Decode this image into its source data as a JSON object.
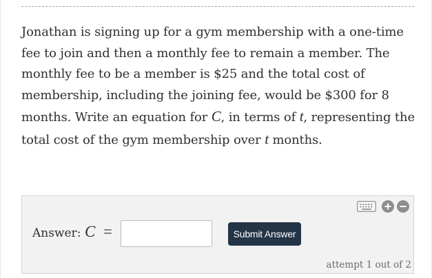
{
  "question": {
    "segments": [
      {
        "type": "text",
        "value": "Jonathan is signing up for a gym membership with a one-time fee to join and then a monthly fee to remain a member. The monthly fee to be a member is $25 and the total cost of membership, including the joining fee, would be $300 for 8 months. Write an equation for "
      },
      {
        "type": "math",
        "value": "C"
      },
      {
        "type": "text",
        "value": ", in terms of "
      },
      {
        "type": "math",
        "value": "t"
      },
      {
        "type": "text",
        "value": ", representing the total cost of the gym membership over "
      },
      {
        "type": "math",
        "value": "t"
      },
      {
        "type": "text",
        "value": " months."
      }
    ]
  },
  "answer": {
    "label": "Answer:",
    "variable": "C",
    "equals": "=",
    "input_value": "",
    "submit_label": "Submit Answer",
    "attempt_text": "attempt 1 out of 2"
  },
  "toolbar": {
    "icons": [
      "keyboard-icon",
      "plus-icon",
      "minus-icon"
    ]
  },
  "colors": {
    "button_bg": "#243447",
    "panel_bg": "#f2f2f2",
    "text": "#2f2f2f",
    "icon_gray": "#8e8e8e"
  }
}
